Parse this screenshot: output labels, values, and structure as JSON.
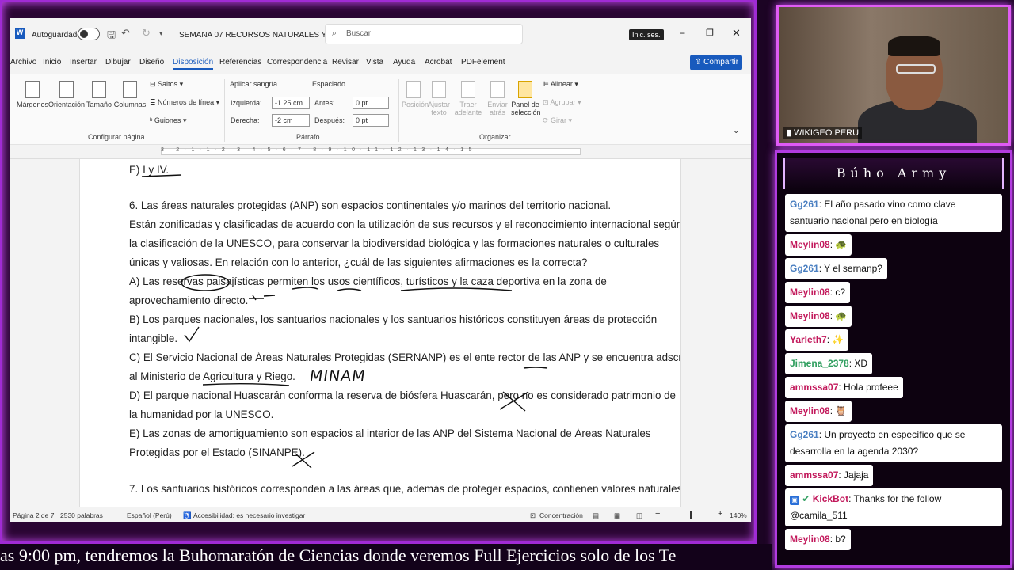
{
  "word": {
    "autosave_label": "Autoguardado",
    "doc_title": "SEMANA 07 RECURSOS NATURALES Y...",
    "search_placeholder": "Buscar",
    "signin": "Inic. ses.",
    "menu": [
      "Archivo",
      "Inicio",
      "Insertar",
      "Dibujar",
      "Diseño",
      "Disposición",
      "Referencias",
      "Correspondencia",
      "Revisar",
      "Vista",
      "Ayuda",
      "Acrobat",
      "PDFelement"
    ],
    "share": "Compartir",
    "ribbon": {
      "margenes": "Márgenes",
      "orientacion": "Orientación",
      "tamano": "Tamaño",
      "columnas": "Columnas",
      "saltos": "Saltos",
      "numeros_linea": "Números de línea",
      "guiones": "Guiones",
      "config_pagina": "Configurar página",
      "aplicar_sangria": "Aplicar sangría",
      "izquierda": "Izquierda:",
      "izquierda_val": "-1.25 cm",
      "derecha": "Derecha:",
      "derecha_val": "-2 cm",
      "espaciado": "Espaciado",
      "antes": "Antes:",
      "antes_val": "0 pt",
      "despues": "Después:",
      "despues_val": "0 pt",
      "parrafo": "Párrafo",
      "posicion": "Posición",
      "ajustar_texto": "Ajustar texto",
      "traer_adelante": "Traer adelante",
      "enviar_atras": "Enviar atrás",
      "panel_seleccion": "Panel de selección",
      "alinear": "Alinear",
      "agrupar": "Agrupar",
      "girar": "Girar",
      "organizar": "Organizar"
    },
    "ruler_nums": "3·2·1·1·2·3·4·5·6·7·8·9·10·11·12·13·14·15",
    "doc_lines": [
      "E) I y IV.",
      "6. Las áreas naturales protegidas (ANP) son espacios continentales y/o marinos del territorio nacional.",
      "Están zonificadas y clasificadas de acuerdo con la utilización de sus recursos y el reconocimiento internacional según",
      "la clasificación de la UNESCO, para conservar la biodiversidad biológica y las formaciones naturales o culturales",
      "únicas y valiosas. En relación con lo anterior, ¿cuál de las siguientes afirmaciones es la correcta?",
      "A) Las reservas paisajísticas permiten los usos científicos, turísticos y la caza deportiva en la zona de",
      "aprovechamiento directo.",
      "B) Los parques nacionales, los santuarios nacionales y los santuarios históricos constituyen áreas de protección",
      "intangible.",
      "C) El Servicio Nacional de Áreas Naturales Protegidas (SERNANP) es el ente rector de las ANP y se encuentra adscrito",
      "al Ministerio de Agricultura y Riego.",
      "D) El parque nacional Huascarán conforma la reserva de biósfera Huascarán, pero no es considerado patrimonio de",
      "la humanidad por la UNESCO.",
      "E) Las zonas de amortiguamiento son espacios al interior de las ANP del Sistema Nacional de Áreas Naturales",
      "Protegidas por el Estado (SINANPE).",
      "7. Los santuarios históricos corresponden a las áreas que, además de proteger espacios, contienen valores naturales"
    ],
    "handwritten_minam": "MINAM",
    "status": {
      "page": "Página 2 de 7",
      "words": "2530 palabras",
      "lang": "Español (Perú)",
      "access": "Accesibilidad: es necesario investigar",
      "focus": "Concentración",
      "zoom": "140%"
    }
  },
  "camera": {
    "label": "WIKIGEO PERU"
  },
  "chat": {
    "title": "Búho Army",
    "messages": [
      {
        "user": "Gg261",
        "color": "#4a7fc1",
        "text": ": El año pasado vino como clave santuario nacional pero en biología"
      },
      {
        "user": "Meylin08",
        "color": "#c2185b",
        "text": ": 🐢"
      },
      {
        "user": "Gg261",
        "color": "#4a7fc1",
        "text": ": Y el sernanp?"
      },
      {
        "user": "Meylin08",
        "color": "#c2185b",
        "text": ": c?"
      },
      {
        "user": "Meylin08",
        "color": "#c2185b",
        "text": ": 🐢"
      },
      {
        "user": "Yarleth7",
        "color": "#c2185b",
        "text": ": ✨"
      },
      {
        "user": "Jimena_2378",
        "color": "#2e9e5e",
        "text": ": XD"
      },
      {
        "user": "ammssa07",
        "color": "#c2185b",
        "text": ": Hola profeee"
      },
      {
        "user": "Meylin08",
        "color": "#c2185b",
        "text": ": 🦉"
      },
      {
        "user": "Gg261",
        "color": "#4a7fc1",
        "text": ": Un proyecto en específico que se desarrolla en la agenda 2030?"
      },
      {
        "user": "ammssa07",
        "color": "#c2185b",
        "text": ": Jajaja"
      },
      {
        "user": "KickBot",
        "color": "#c2185b",
        "text": ": Thanks for the follow @camila_511"
      },
      {
        "user": "Meylin08",
        "color": "#c2185b",
        "text": ": b?"
      }
    ]
  },
  "ticker": "as 9:00 pm, tendremos la Buhomaratón de Ciencias donde veremos Full Ejercicios solo de los Te"
}
